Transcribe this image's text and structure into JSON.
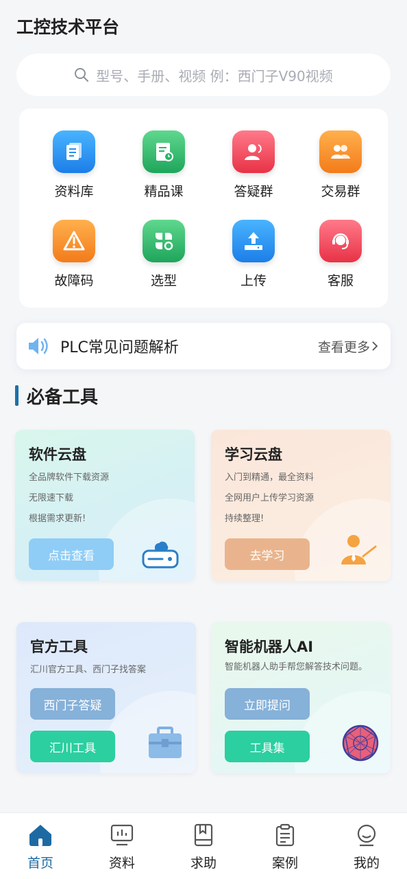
{
  "header": {
    "title": "工控技术平台"
  },
  "search": {
    "placeholder": "型号、手册、视频 例：西门子V90视频",
    "icon": "search-icon"
  },
  "grid": [
    {
      "label": "资料库",
      "icon": "document-library-icon",
      "color": "#2a8ff0"
    },
    {
      "label": "精品课",
      "icon": "course-icon",
      "color": "#28b56a"
    },
    {
      "label": "答疑群",
      "icon": "qa-group-icon",
      "color": "#f04a5d"
    },
    {
      "label": "交易群",
      "icon": "trade-group-icon",
      "color": "#f6902a"
    },
    {
      "label": "故障码",
      "icon": "warning-icon",
      "color": "#f6902a"
    },
    {
      "label": "选型",
      "icon": "selection-icon",
      "color": "#28b56a"
    },
    {
      "label": "上传",
      "icon": "upload-icon",
      "color": "#2a8ff0"
    },
    {
      "label": "客服",
      "icon": "customer-service-icon",
      "color": "#f04a5d"
    }
  ],
  "notice": {
    "text": "PLC常见问题解析",
    "more": "查看更多",
    "icon": "speaker-icon"
  },
  "section": {
    "title": "必备工具"
  },
  "tools": [
    {
      "title": "软件云盘",
      "desc": [
        "全品牌软件下载资源",
        "无限速下载",
        "根据需求更新!"
      ],
      "buttons": [
        "点击查看"
      ],
      "icon": "cloud-drive-icon"
    },
    {
      "title": "学习云盘",
      "desc": [
        "入门到精通，最全资料",
        "全网用户上传学习资源",
        "持续整理!"
      ],
      "buttons": [
        "去学习"
      ],
      "icon": "teacher-icon"
    },
    {
      "title": "官方工具",
      "desc": [
        "汇川官方工具、西门子找答案"
      ],
      "buttons": [
        "西门子答疑",
        "汇川工具"
      ],
      "icon": "toolbox-icon"
    },
    {
      "title": "智能机器人AI",
      "desc": [
        "智能机器人助手帮您解答技术问题。"
      ],
      "buttons": [
        "立即提问",
        "工具集"
      ],
      "icon": "ai-sphere-icon"
    }
  ],
  "tabbar": [
    {
      "label": "首页",
      "icon": "home-icon",
      "active": true
    },
    {
      "label": "资料",
      "icon": "monitor-chart-icon"
    },
    {
      "label": "求助",
      "icon": "book-icon"
    },
    {
      "label": "案例",
      "icon": "clipboard-icon"
    },
    {
      "label": "我的",
      "icon": "user-icon"
    }
  ],
  "colors": {
    "accent": "#1d6aa3",
    "teal": "#2bcfa0"
  }
}
